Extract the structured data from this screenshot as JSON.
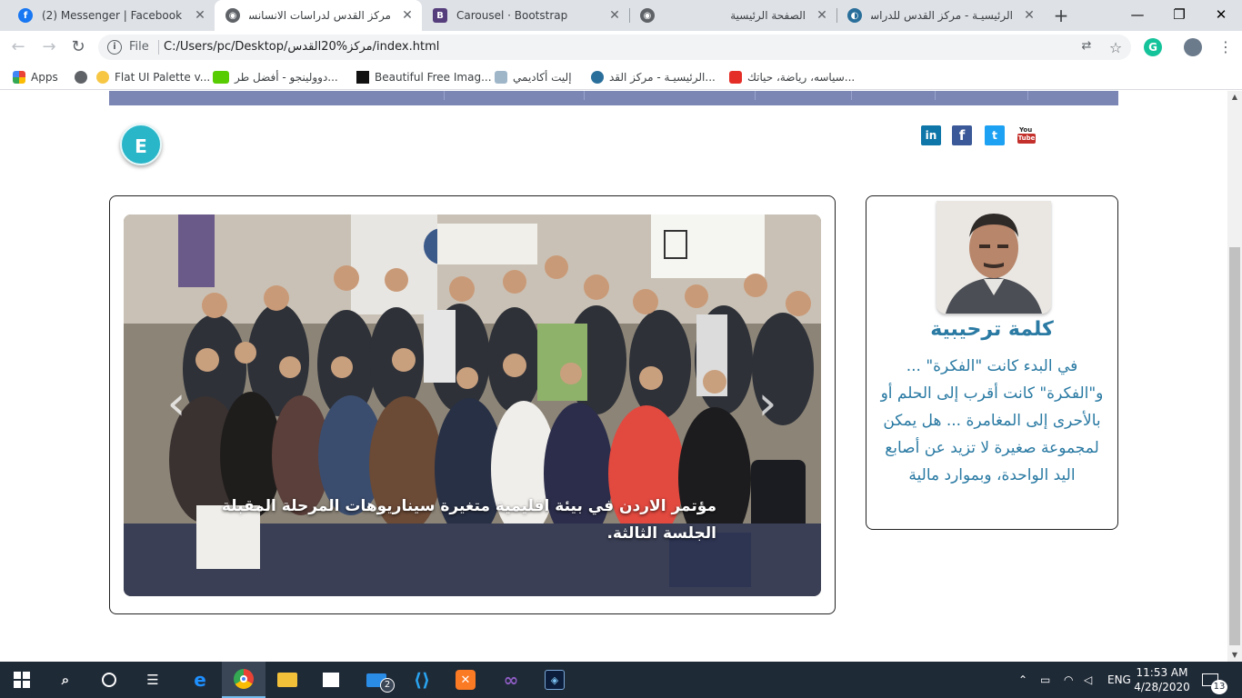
{
  "browser": {
    "tabs": [
      {
        "title": "(2) Messenger | Facebook",
        "icon": "facebook-icon",
        "color": "#1877f2",
        "active": false
      },
      {
        "title": "مركز القدس لدراسات الانسانسة",
        "icon": "globe-icon",
        "color": "#5f6368",
        "active": true
      },
      {
        "title": "Carousel · Bootstrap",
        "icon": "bootstrap-icon",
        "color": "#563d7c",
        "active": false
      },
      {
        "title": "الصفحة الرئيسية",
        "icon": "globe-icon",
        "color": "#5f6368",
        "active": false
      },
      {
        "title": "الرئيسيـة - مركز القدس للدراسات",
        "icon": "site-logo-icon",
        "color": "#2a6f9b",
        "active": false
      }
    ],
    "address": {
      "scheme": "File",
      "url": "C:/Users/pc/Desktop/مركز%20القدس/index.html"
    },
    "bookmarks": [
      {
        "label": "Apps",
        "icon": "apps-grid-icon"
      },
      {
        "label": "",
        "icon": "globe-icon"
      },
      {
        "label": "Flat UI Palette v...",
        "icon": "emoji-icon"
      },
      {
        "label": "دوولينجو - أفضل طر...",
        "icon": "duolingo-icon"
      },
      {
        "label": "Beautiful Free Imag...",
        "icon": "unsplash-icon"
      },
      {
        "label": "إليت أكاديمي",
        "icon": "elite-icon"
      },
      {
        "label": "الرئيسيـة - مركز القد...",
        "icon": "site-logo-icon"
      },
      {
        "label": "سياسه، رياضة، حياتك...",
        "icon": "news-icon"
      }
    ]
  },
  "page": {
    "lang_badge": "E",
    "social": [
      "linkedin-icon",
      "facebook-icon",
      "twitter-icon",
      "youtube-icon"
    ],
    "carousel": {
      "caption": "مؤتمر الاردن في بيئة اقليمية متغيرة سيناريوهات المرحلة المقبلة الجلسة الثالثة.",
      "prev": "‹",
      "next": "›"
    },
    "welcome": {
      "title": "كلمة ترحيبية",
      "text": "في البدء كانت \"الفكرة\" ... و\"الفكرة\" كانت أقرب إلى الحلم أو بالأحرى إلى المغامرة ... هل يمكن لمجموعة صغيرة لا تزيد عن أصابع اليد الواحدة، وبموارد مالية"
    },
    "colors": {
      "nav": "#7b86b5",
      "accent": "#2a7aa3",
      "badge": "#29b6c9"
    }
  },
  "taskbar": {
    "apps": [
      "windows-start-icon",
      "search-icon",
      "cortana-icon",
      "task-view-icon",
      "edge-icon",
      "chrome-icon",
      "file-explorer-icon",
      "store-icon",
      "mail-icon",
      "vscode-icon",
      "xampp-icon",
      "visual-studio-icon",
      "photoshop-icon"
    ],
    "mail_badge": "2",
    "lang": "ENG",
    "time": "11:53 AM",
    "date": "4/28/2020",
    "notifications": "13"
  }
}
